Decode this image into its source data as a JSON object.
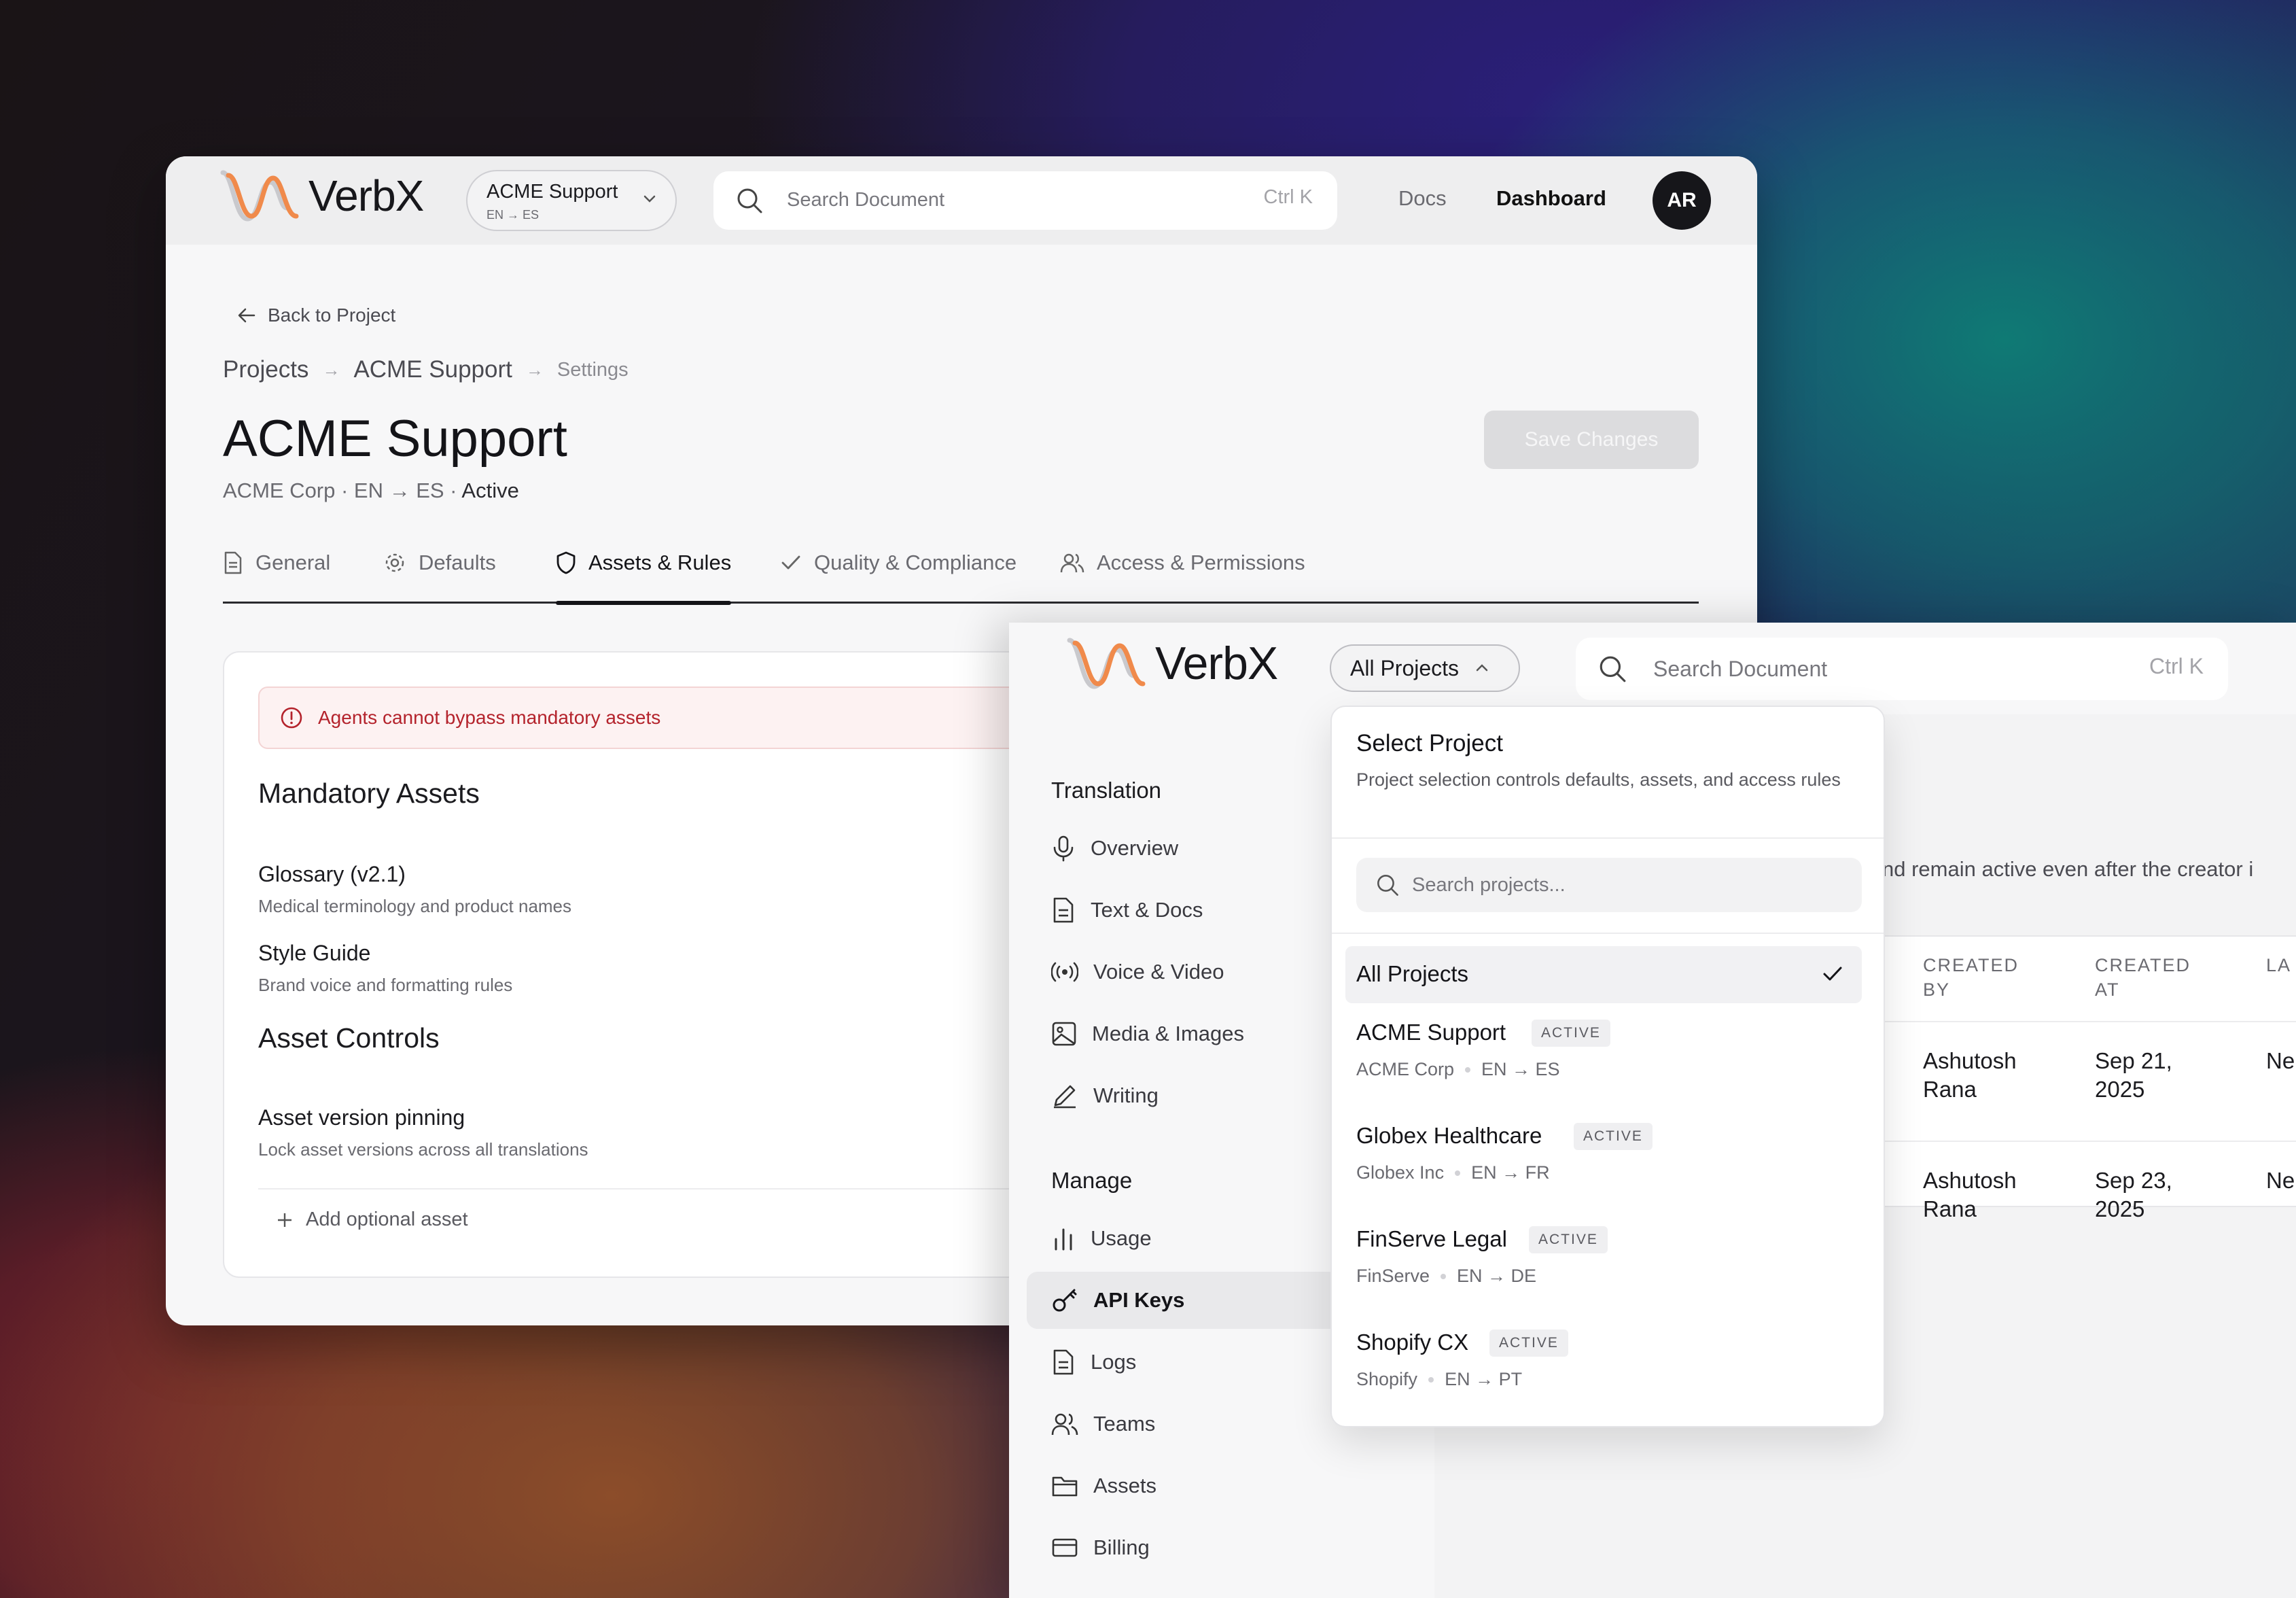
{
  "brand": {
    "name": "VerbX",
    "accent": "#f08a4b",
    "dark": "#17171b"
  },
  "back_window": {
    "project_pill": {
      "name": "ACME Support",
      "langs": "EN → ES"
    },
    "search": {
      "placeholder": "Search Document",
      "shortcut": "Ctrl K"
    },
    "nav": {
      "docs": "Docs",
      "dashboard": "Dashboard"
    },
    "avatar": "AR",
    "back_link": "Back to Project",
    "breadcrumb": [
      "Projects",
      "ACME Support",
      "Settings"
    ],
    "breadcrumb_sep": "→",
    "title": "ACME Support",
    "subtitle_prefix": "ACME Corp · EN → ES · ",
    "subtitle_status": "Active",
    "save_button": "Save Changes",
    "tabs": [
      {
        "label": "General",
        "icon": "document-icon"
      },
      {
        "label": "Defaults",
        "icon": "gear-icon"
      },
      {
        "label": "Assets & Rules",
        "icon": "shield-icon",
        "selected": true
      },
      {
        "label": "Quality & Compliance",
        "icon": "check-icon"
      },
      {
        "label": "Access & Permissions",
        "icon": "users-icon"
      }
    ],
    "alert": "Agents cannot bypass mandatory assets",
    "mandatory_heading": "Mandatory Assets",
    "mandatory_assets": [
      {
        "title": "Glossary (v2.1)",
        "desc": "Medical terminology and product names"
      },
      {
        "title": "Style Guide",
        "desc": "Brand voice and formatting rules"
      }
    ],
    "controls_heading": "Asset Controls",
    "controls": [
      {
        "title": "Asset version pinning",
        "desc": "Lock asset versions across all translations"
      }
    ],
    "add_optional": "Add optional asset"
  },
  "front_window": {
    "project_pill": "All Projects",
    "search": {
      "placeholder": "Search Document",
      "shortcut": "Ctrl K"
    },
    "sidebar": {
      "sections": [
        {
          "label": "Translation",
          "items": [
            {
              "label": "Overview",
              "icon": "microphone-icon"
            },
            {
              "label": "Text & Docs",
              "icon": "document-icon"
            },
            {
              "label": "Voice & Video",
              "icon": "broadcast-icon"
            },
            {
              "label": "Media & Images",
              "icon": "image-icon"
            },
            {
              "label": "Writing",
              "icon": "pen-icon"
            }
          ]
        },
        {
          "label": "Manage",
          "items": [
            {
              "label": "Usage",
              "icon": "bar-chart-icon"
            },
            {
              "label": "API Keys",
              "icon": "key-icon",
              "selected": true
            },
            {
              "label": "Logs",
              "icon": "document-icon"
            },
            {
              "label": "Teams",
              "icon": "users-icon"
            },
            {
              "label": "Assets",
              "icon": "folder-icon"
            },
            {
              "label": "Billing",
              "icon": "card-icon"
            }
          ]
        }
      ]
    },
    "content_fragment": "nd remain active even after the creator i",
    "table": {
      "headers": [
        [
          "CREATED",
          "BY"
        ],
        [
          "CREATED",
          "AT"
        ],
        [
          "LA",
          ""
        ]
      ],
      "rows": [
        {
          "by": [
            "Ashutosh",
            "Rana"
          ],
          "at": [
            "Sep 21,",
            "2025"
          ],
          "last": "Ne"
        },
        {
          "by": [
            "Ashutosh",
            "Rana"
          ],
          "at": [
            "Sep 23,",
            "2025"
          ],
          "last": "Ne"
        }
      ]
    }
  },
  "dropdown": {
    "title": "Select Project",
    "description": "Project selection controls defaults, assets, and access rules",
    "search_placeholder": "Search projects...",
    "selected_option": "All Projects",
    "projects": [
      {
        "name": "ACME Support",
        "status": "ACTIVE",
        "org": "ACME Corp",
        "langs": "EN → ES"
      },
      {
        "name": "Globex Healthcare",
        "status": "ACTIVE",
        "org": "Globex Inc",
        "langs": "EN → FR"
      },
      {
        "name": "FinServe Legal",
        "status": "ACTIVE",
        "org": "FinServe",
        "langs": "EN → DE"
      },
      {
        "name": "Shopify CX",
        "status": "ACTIVE",
        "org": "Shopify",
        "langs": "EN → PT"
      }
    ]
  }
}
